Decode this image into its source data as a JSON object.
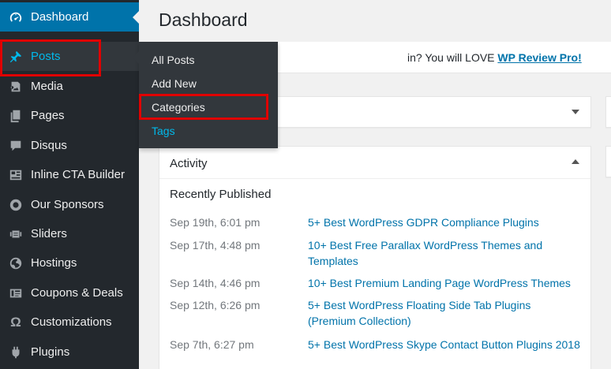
{
  "sidebar": {
    "items": [
      {
        "label": "Dashboard",
        "icon": "dashboard-icon"
      },
      {
        "label": "Posts",
        "icon": "pin-icon"
      },
      {
        "label": "Media",
        "icon": "media-icon"
      },
      {
        "label": "Pages",
        "icon": "pages-icon"
      },
      {
        "label": "Disqus",
        "icon": "comment-icon"
      },
      {
        "label": "Inline CTA Builder",
        "icon": "layout-icon"
      },
      {
        "label": "Our Sponsors",
        "icon": "circle-icon"
      },
      {
        "label": "Sliders",
        "icon": "slides-icon"
      },
      {
        "label": "Hostings",
        "icon": "globe-icon"
      },
      {
        "label": "Coupons & Deals",
        "icon": "tickets-icon"
      },
      {
        "label": "Customizations",
        "icon": "omega-icon"
      },
      {
        "label": "Plugins",
        "icon": "plugin-icon"
      }
    ]
  },
  "flyout": {
    "items": [
      "All Posts",
      "Add New",
      "Categories",
      "Tags"
    ]
  },
  "main": {
    "title": "Dashboard",
    "notice_prefix": "in? You will LOVE ",
    "notice_link": "WP Review Pro!",
    "activity": {
      "title": "Activity",
      "recently_published": "Recently Published",
      "rows": [
        {
          "date": "Sep 19th, 6:01 pm",
          "title": "5+ Best WordPress GDPR Compliance Plugins"
        },
        {
          "date": "Sep 17th, 4:48 pm",
          "title": "10+ Best Free Parallax WordPress Themes and Templates"
        },
        {
          "date": "Sep 14th, 4:46 pm",
          "title": "10+ Best Premium Landing Page WordPress Themes"
        },
        {
          "date": "Sep 12th, 6:26 pm",
          "title": "5+ Best WordPress Floating Side Tab Plugins (Premium Collection)"
        },
        {
          "date": "Sep 7th, 6:27 pm",
          "title": "5+ Best WordPress Skype Contact Button Plugins 2018"
        }
      ]
    }
  },
  "colors": {
    "sidebar_bg": "#23282d",
    "current_bg": "#0073aa",
    "link": "#0073aa",
    "highlight": "#e00000"
  }
}
